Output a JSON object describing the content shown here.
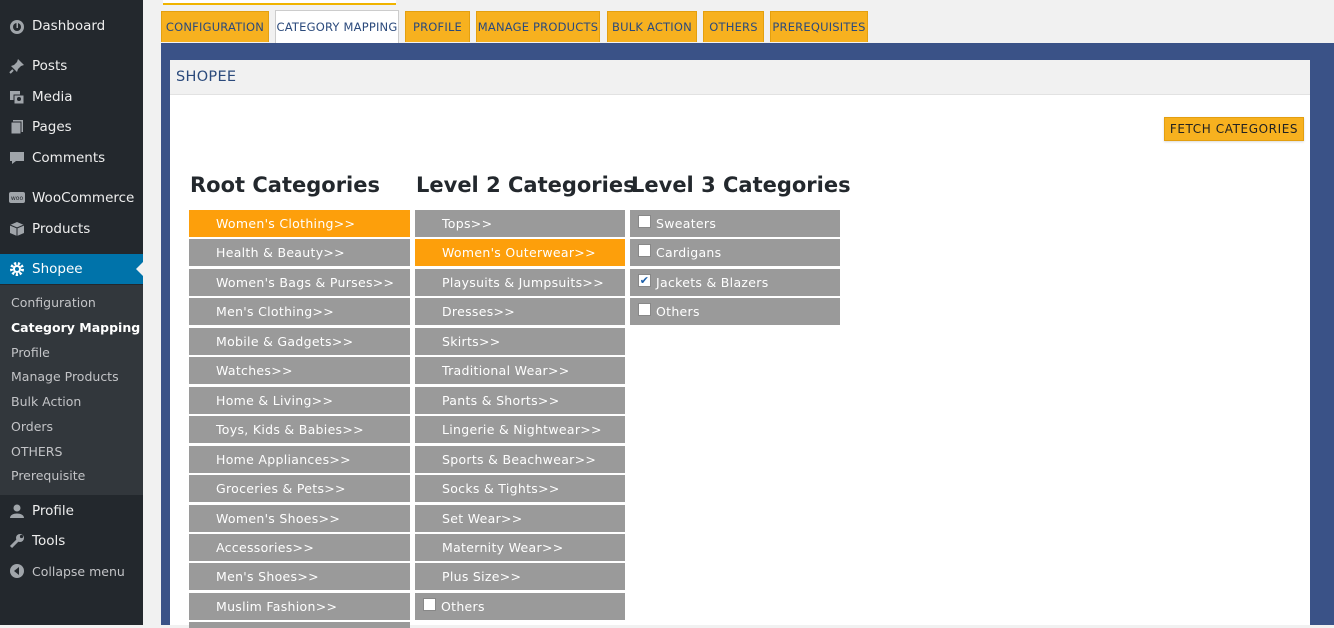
{
  "sidebar": {
    "dashboard": "Dashboard",
    "posts": "Posts",
    "media": "Media",
    "pages": "Pages",
    "comments": "Comments",
    "woocommerce": "WooCommerce",
    "products": "Products",
    "shopee": "Shopee",
    "submenu": [
      "Configuration",
      "Category Mapping",
      "Profile",
      "Manage Products",
      "Bulk Action",
      "Orders",
      "OTHERS",
      "Prerequisite"
    ],
    "profile": "Profile",
    "tools": "Tools",
    "collapse": "Collapse menu"
  },
  "tabs": [
    "CONFIGURATION",
    "CATEGORY MAPPING",
    "PROFILE",
    "MANAGE PRODUCTS",
    "BULK ACTION",
    "OTHERS",
    "PREREQUISITES"
  ],
  "panel": {
    "title": "SHOPEE",
    "fetch_button": "FETCH CATEGORIES"
  },
  "columns": {
    "root_title": "Root Categories",
    "level2_title": "Level 2 Categories",
    "level3_title": "Level 3 Categories",
    "root": [
      "Women's Clothing>>",
      "Health & Beauty>>",
      "Women's Bags & Purses>>",
      "Men's Clothing>>",
      "Mobile & Gadgets>>",
      "Watches>>",
      "Home & Living>>",
      "Toys, Kids & Babies>>",
      "Home Appliances>>",
      "Groceries & Pets>>",
      "Women's Shoes>>",
      "Accessories>>",
      "Men's Shoes>>",
      "Muslim Fashion>>"
    ],
    "level2": [
      "Tops>>",
      "Women's Outerwear>>",
      "Playsuits & Jumpsuits>>",
      "Dresses>>",
      "Skirts>>",
      "Traditional Wear>>",
      "Pants & Shorts>>",
      "Lingerie & Nightwear>>",
      "Sports & Beachwear>>",
      "Socks & Tights>>",
      "Set Wear>>",
      "Maternity Wear>>",
      "Plus Size>>",
      "Others"
    ],
    "level3": [
      "Sweaters",
      "Cardigans",
      "Jackets & Blazers",
      "Others"
    ],
    "level3_checked": [
      false,
      false,
      true,
      false
    ],
    "level2_others_checked": false,
    "selected_color": "#fd9f0b",
    "item_color": "#9a9a9a"
  }
}
